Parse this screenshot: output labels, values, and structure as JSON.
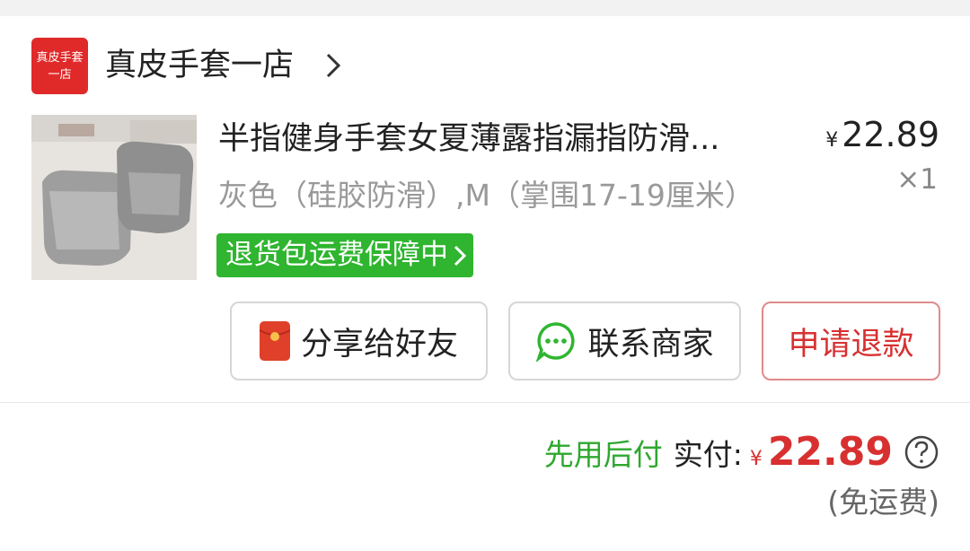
{
  "store": {
    "logo_line1": "真皮手套",
    "logo_line2": "一店",
    "name": "真皮手套一店"
  },
  "product": {
    "title": "半指健身手套女夏薄露指漏指防滑...",
    "price_symbol": "¥",
    "price": "22.89",
    "quantity": "×1",
    "sku": "灰色（硅胶防滑）,M（掌围17-19厘米）",
    "guarantee": "退货包运费保障中"
  },
  "actions": {
    "share": "分享给好友",
    "contact": "联系商家",
    "refund": "申请退款"
  },
  "summary": {
    "pay_later": "先用后付",
    "paid_label": "实付:",
    "currency": "¥",
    "total": "22.89",
    "shipping": "(免运费)"
  },
  "colors": {
    "accent_red": "#d83030",
    "green": "#2fb52f"
  }
}
